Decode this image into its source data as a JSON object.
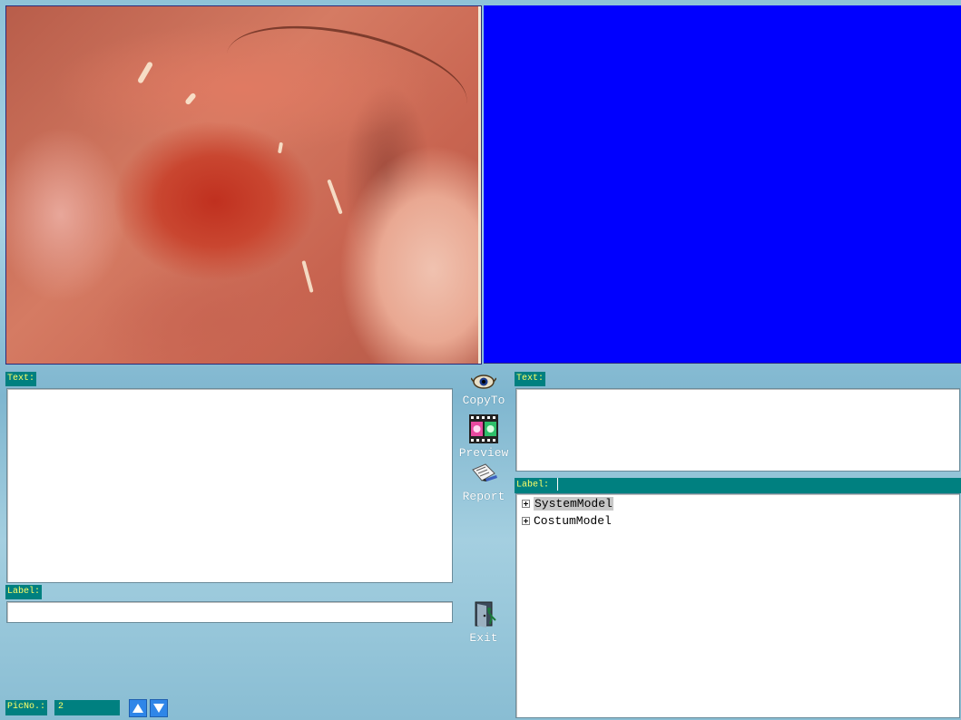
{
  "left_panel": {
    "text_label": "Text:",
    "label_label": "Label:",
    "label_value": "",
    "picno_label": "PicNo.:",
    "picno_value": "2"
  },
  "right_panel": {
    "text_label": "Text:",
    "label_label": "Label:",
    "tree": [
      {
        "label": "SystemModel",
        "selected": true
      },
      {
        "label": "CostumModel",
        "selected": false
      }
    ]
  },
  "actions": {
    "copyto": "CopyTo",
    "preview": "Preview",
    "report": "Report",
    "exit": "Exit"
  },
  "icons": {
    "copyto": "eye-icon",
    "preview": "film-icon",
    "report": "document-pen-icon",
    "exit": "exit-door-icon",
    "up": "arrow-up-icon",
    "down": "arrow-down-icon"
  },
  "colors": {
    "tag_bg": "#008080",
    "tag_text": "#ffff66",
    "right_image_bg": "#0000ff",
    "arrow_bg": "#2f86e8"
  }
}
